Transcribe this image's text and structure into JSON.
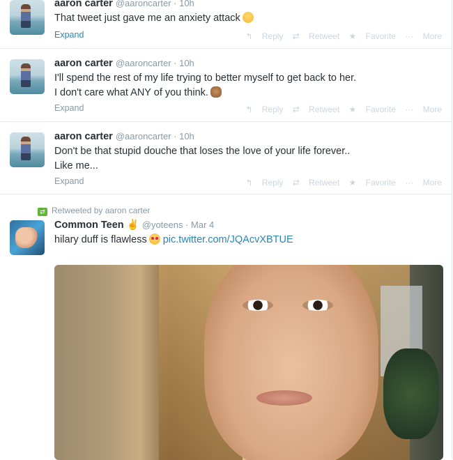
{
  "tweets": [
    {
      "name": "aaron carter",
      "handle": "@aaroncarter · 10h",
      "lines": [
        "That tweet just gave me an anxiety attack"
      ],
      "expand": "Expand",
      "actions": {
        "reply": "Reply",
        "retweet": "Retweet",
        "favorite": "Favorite",
        "more": "More"
      }
    },
    {
      "name": "aaron carter",
      "handle": "@aaroncarter · 10h",
      "lines": [
        "I'll spend the rest of my life trying to better myself to get back to her.",
        "I don't care what ANY of you think."
      ],
      "expand": "Expand",
      "actions": {
        "reply": "Reply",
        "retweet": "Retweet",
        "favorite": "Favorite",
        "more": "More"
      }
    },
    {
      "name": "aaron carter",
      "handle": "@aaroncarter · 10h",
      "lines": [
        "Don't be that stupid douche that loses the love of your life forever..",
        "Like me..."
      ],
      "expand": "Expand",
      "actions": {
        "reply": "Reply",
        "retweet": "Retweet",
        "favorite": "Favorite",
        "more": "More"
      }
    },
    {
      "retweeted_by": "Retweeted by aaron carter",
      "name": "Common Teen",
      "handle": "@yoteens · Mar 4",
      "text": "hilary duff is flawless",
      "link": "pic.twitter.com/JQAcvXBTUE"
    }
  ],
  "icons": {
    "emoji_1": "worried-face-icon",
    "emoji_2": "see-no-evil-monkey-icon",
    "emoji_3": "heart-eyes-icon",
    "retweet": "retweet-icon"
  },
  "colors": {
    "link": "#2a86b5",
    "retweet_green": "#5fb536",
    "muted": "#8899a6"
  }
}
